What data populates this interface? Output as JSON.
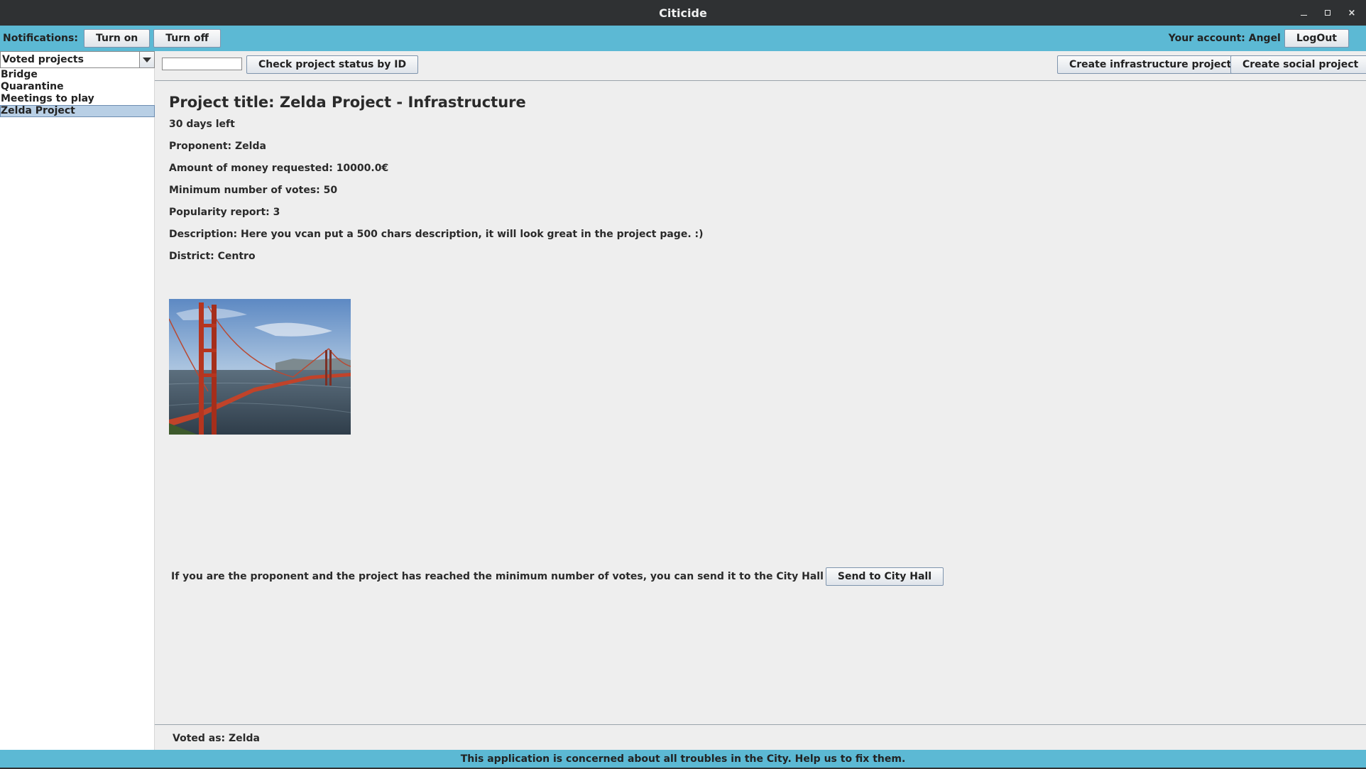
{
  "window": {
    "title": "Citicide",
    "minimize_label": "",
    "maximize_label": "",
    "close_label": "×"
  },
  "notifications": {
    "label": "Notifications:",
    "turn_on": "Turn on",
    "turn_off": "Turn off"
  },
  "account": {
    "label": "Your account: Angel",
    "logout": "LogOut"
  },
  "sidebar": {
    "filter_selected": "Voted projects",
    "projects": [
      {
        "label": "Bridge",
        "selected": false
      },
      {
        "label": "Quarantine",
        "selected": false
      },
      {
        "label": "Meetings to play",
        "selected": false
      },
      {
        "label": "Zelda Project",
        "selected": true
      }
    ]
  },
  "toolbar": {
    "id_input_value": "",
    "check_status": "Check project status by ID",
    "create_infrastructure": "Create infrastructure project",
    "create_social": "Create social project"
  },
  "project": {
    "title": "Project title: Zelda Project - Infrastructure",
    "days_left": "30 days left",
    "proponent": "Proponent: Zelda",
    "money": "Amount of money requested: 10000.0€",
    "min_votes": "Minimum number of votes: 50",
    "popularity": "Popularity report: 3",
    "description": "Description: Here you vcan put a 500 chars description, it will look great in the project page. :)",
    "district": "District: Centro"
  },
  "send": {
    "text": "If you are the proponent and the project has reached the minimum number of votes, you can send it to the City Hall",
    "button": "Send to City Hall"
  },
  "voted_as": "Voted as: Zelda",
  "footer": "This application is concerned about all troubles in the City. Help us to fix them.",
  "colors": {
    "accent_bar": "#5cb9d4",
    "titlebar": "#2f3133",
    "selection": "#b8cfe5"
  }
}
